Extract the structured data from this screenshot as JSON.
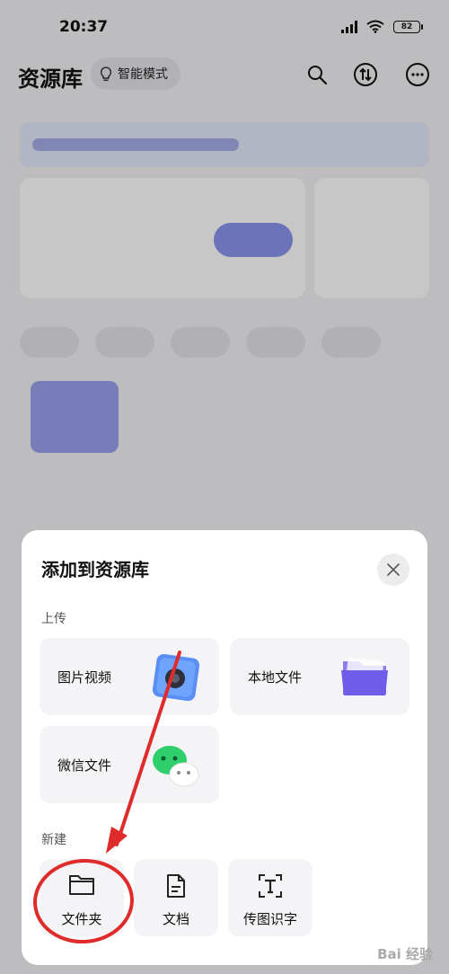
{
  "status_bar": {
    "time": "20:37",
    "battery": "82"
  },
  "header": {
    "title": "资源库",
    "mode_label": "智能模式"
  },
  "sheet": {
    "title": "添加到资源库",
    "upload_section": "上传",
    "upload_items": [
      {
        "label": "图片视频",
        "icon": "photo-video-icon"
      },
      {
        "label": "本地文件",
        "icon": "folder-icon"
      },
      {
        "label": "微信文件",
        "icon": "wechat-icon"
      }
    ],
    "create_section": "新建",
    "create_items": [
      {
        "label": "文件夹",
        "icon": "folder-outline-icon"
      },
      {
        "label": "文档",
        "icon": "document-icon"
      },
      {
        "label": "传图识字",
        "icon": "ocr-text-icon"
      }
    ]
  },
  "colors": {
    "accent": "#6b7be8",
    "annotation": "#e02b2b"
  }
}
